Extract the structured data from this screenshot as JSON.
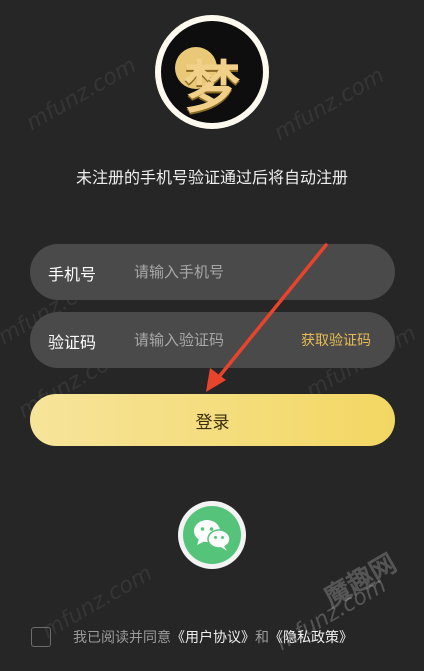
{
  "logo": {
    "char": "梦"
  },
  "subtitle": "未注册的手机号验证通过后将自动注册",
  "phone": {
    "label": "手机号",
    "placeholder": "请输入手机号",
    "value": ""
  },
  "code": {
    "label": "验证码",
    "placeholder": "请输入验证码",
    "value": "",
    "get_code": "获取验证码"
  },
  "login_button": "登录",
  "agreement": {
    "prefix": "我已阅读并同意",
    "user_agreement": "《用户协议》",
    "and": "和",
    "privacy_policy": "《隐私政策》",
    "checked": false
  },
  "watermark": {
    "text": "mfunz.com",
    "brand": "魔趣网"
  },
  "colors": {
    "background": "#262626",
    "field": "#4a4a4a",
    "accent": "#e8bc54",
    "button": "#f3d763",
    "wechat": "#55c47a",
    "arrow": "#e8432d"
  },
  "icons": {
    "wechat": "wechat-icon"
  }
}
